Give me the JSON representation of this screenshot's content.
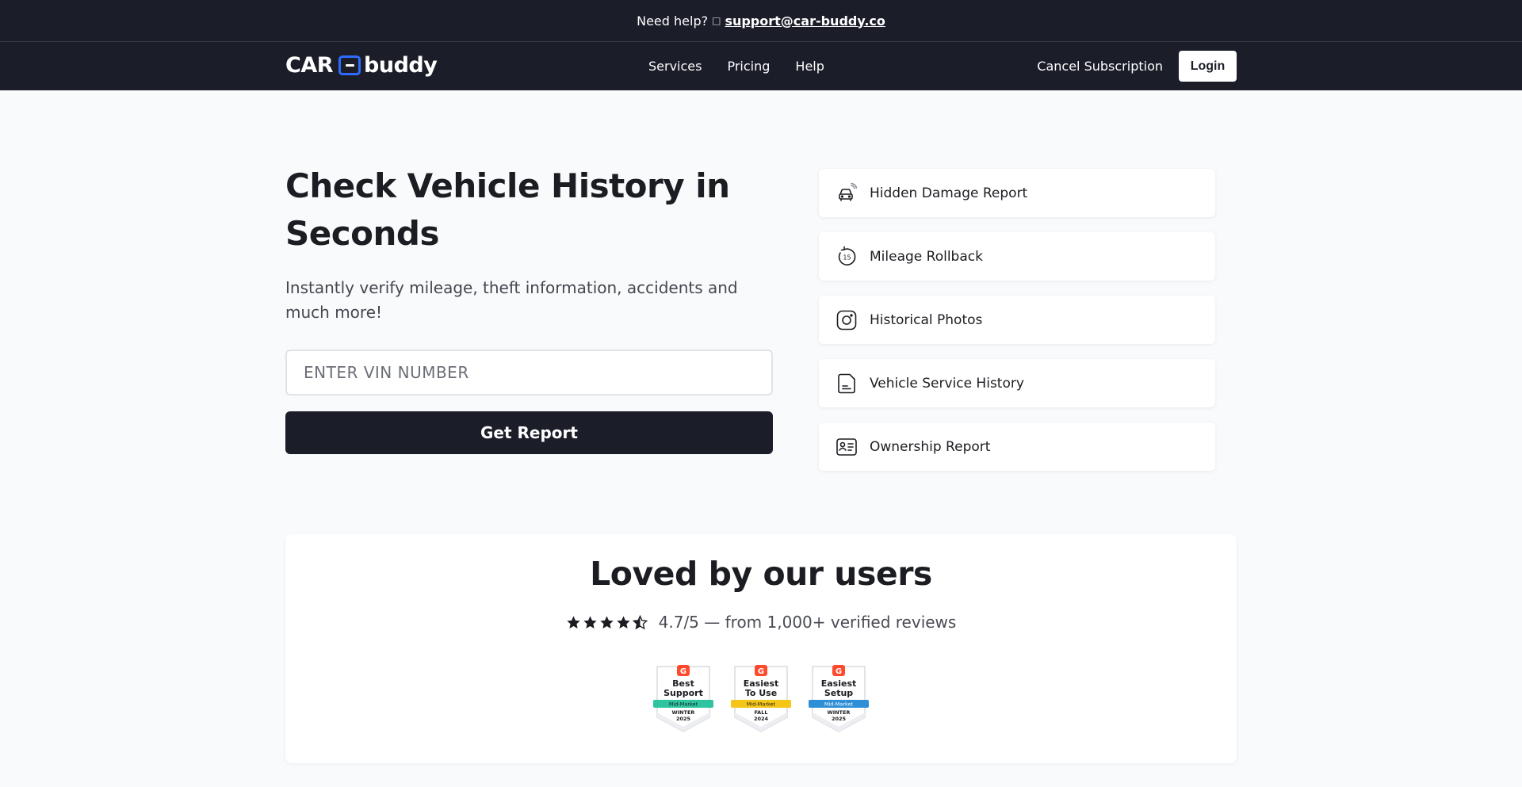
{
  "topbar": {
    "help_text": "Need help?",
    "email": "support@car-buddy.co"
  },
  "nav": {
    "logo_left": "CAR",
    "logo_right": "buddy",
    "links": [
      "Services",
      "Pricing",
      "Help"
    ],
    "cancel": "Cancel Subscription",
    "login": "Login"
  },
  "hero": {
    "title": "Check Vehicle History in Seconds",
    "subtitle": "Instantly verify mileage, theft information, accidents and much more!",
    "vin_placeholder": "ENTER VIN NUMBER",
    "button": "Get Report"
  },
  "features": [
    {
      "label": "Hidden Damage Report",
      "icon": "car-signal-icon"
    },
    {
      "label": "Mileage Rollback",
      "icon": "rollback-15-icon"
    },
    {
      "label": "Historical Photos",
      "icon": "camera-icon"
    },
    {
      "label": "Vehicle Service History",
      "icon": "service-document-icon"
    },
    {
      "label": "Ownership Report",
      "icon": "id-card-icon"
    }
  ],
  "reviews": {
    "title": "Loved by our users",
    "rating_text": "4.7/5 — from 1,000+ verified reviews",
    "stars": 4.5,
    "badges": [
      {
        "line1": "Best",
        "line2": "Support",
        "ribbon": "Mid-Market",
        "season": "WINTER",
        "year": "2025",
        "ribbon_color": "#2ec4a0"
      },
      {
        "line1": "Easiest",
        "line2": "To Use",
        "ribbon": "Mid-Market",
        "season": "FALL",
        "year": "2024",
        "ribbon_color": "#f5c518"
      },
      {
        "line1": "Easiest",
        "line2": "Setup",
        "ribbon": "Mid-Market",
        "season": "WINTER",
        "year": "2025",
        "ribbon_color": "#2e8fd6"
      }
    ]
  },
  "colors": {
    "dark": "#1b1e29",
    "accent": "#2f6bff",
    "g2_red": "#ff492c"
  }
}
